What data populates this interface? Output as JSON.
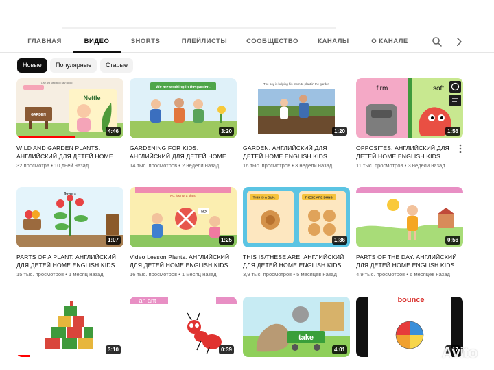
{
  "tabs": [
    {
      "label": "ГЛАВНАЯ"
    },
    {
      "label": "ВИДЕО"
    },
    {
      "label": "SHORTS"
    },
    {
      "label": "ПЛЕЙЛИСТЫ"
    },
    {
      "label": "СООБЩЕСТВО"
    },
    {
      "label": "КАНАЛЫ"
    },
    {
      "label": "О КАНАЛЕ"
    }
  ],
  "active_tab": "ВИДЕО",
  "filters": [
    {
      "label": "Новые",
      "selected": true
    },
    {
      "label": "Популярные",
      "selected": false
    },
    {
      "label": "Старые",
      "selected": false
    }
  ],
  "icons": {
    "search": "search-icon",
    "next": "chevron-right-icon",
    "more": "more-vert-icon"
  },
  "videos": [
    {
      "title": "WILD AND GARDEN PLANTS. АНГЛИЙСКИЙ ДЛЯ ДЕТЕЙ.HOME ENGLISH KIDS",
      "views": "32 просмотра",
      "age": "10 дней назад",
      "duration": "4:46",
      "thumb_text": "Nettle",
      "thumb_text2": "GARDEN",
      "thumb_caption": "Love and Meditation Italy Studio",
      "progress_pct": 0.55
    },
    {
      "title": "GARDENING FOR KIDS. АНГЛИЙСКИЙ ДЛЯ ДЕТЕЙ.HOME ENGLISH KIDS",
      "views": "14 тыс. просмотров",
      "age": "2 недели назад",
      "duration": "3:20",
      "thumb_text": "We are working in the garden."
    },
    {
      "title": "GARDEN. АНГЛИЙСКИЙ ДЛЯ ДЕТЕЙ.HOME ENGLISH KIDS",
      "views": "16 тыс. просмотров",
      "age": "3 недели назад",
      "duration": "1:20",
      "thumb_text": "The boy is helping his mom to plant in the garden"
    },
    {
      "title": "OPPOSITES. АНГЛИЙСКИЙ ДЛЯ ДЕТЕЙ.HOME ENGLISH KIDS",
      "views": "11 тыс. просмотров",
      "age": "3 недели назад",
      "duration": "1:56",
      "thumb_text": "firm",
      "thumb_text2": "soft"
    },
    {
      "title": "PARTS OF A PLANT. АНГЛИЙСКИЙ ДЛЯ ДЕТЕЙ.HOME ENGLISH KIDS",
      "views": "15 тыс. просмотров",
      "age": "1 месяц назад",
      "duration": "1:07",
      "thumb_text": "flowers"
    },
    {
      "title": "Video Lesson Plants. АНГЛИЙСКИЙ ДЛЯ ДЕТЕЙ.HOME ENGLISH KIDS",
      "views": "16 тыс. просмотров",
      "age": "1 месяц назад",
      "duration": "1:25",
      "thumb_text": "No, it's not a plant.",
      "thumb_text2": "NO"
    },
    {
      "title": "THIS IS/THESE ARE. АНГЛИЙСКИЙ ДЛЯ ДЕТЕЙ.HOME ENGLISH KIDS",
      "views": "3,9 тыс. просмотров",
      "age": "5 месяцев назад",
      "duration": "1:36",
      "thumb_text": "THIS IS A BUN.",
      "thumb_text2": "THESE ARE BUNS."
    },
    {
      "title": "PARTS OF THE DAY. АНГЛИЙСКИЙ ДЛЯ ДЕТЕЙ.HOME ENGLISH KIDS.",
      "views": "4,9 тыс. просмотров",
      "age": "6 месяцев назад",
      "duration": "0:56"
    },
    {
      "title": "",
      "views": "",
      "age": "",
      "duration": "3:10",
      "progress_pct": 0.12
    },
    {
      "title": "",
      "views": "",
      "age": "",
      "duration": "0:39",
      "thumb_text": "an ant"
    },
    {
      "title": "",
      "views": "",
      "age": "",
      "duration": "4:01",
      "thumb_text": "take"
    },
    {
      "title": "",
      "views": "",
      "age": "",
      "duration": "1:17",
      "thumb_text": "bounce"
    }
  ],
  "watermark": {
    "text": "Avito"
  }
}
